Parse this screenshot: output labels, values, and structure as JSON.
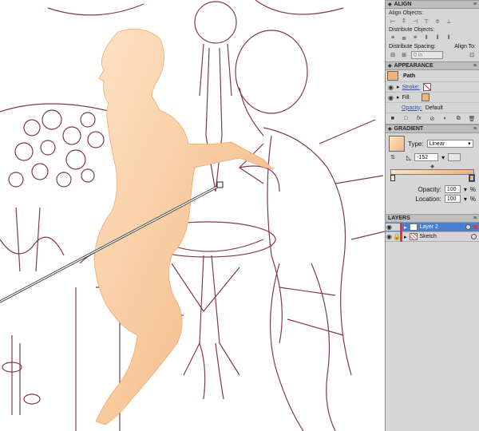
{
  "align": {
    "title": "ALIGN",
    "align_objects_label": "Align Objects:",
    "distribute_objects_label": "Distribute Objects:",
    "distribute_spacing_label": "Distribute Spacing:",
    "align_to_label": "Align To:",
    "spacing_value": "0 in"
  },
  "appearance": {
    "title": "APPEARANCE",
    "object_type": "Path",
    "stroke_label": "Stroke:",
    "fill_label": "Fill:",
    "opacity_label": "Opacity:",
    "opacity_value": "Default",
    "fill_color": "#f3b27a"
  },
  "gradient": {
    "title": "GRADIENT",
    "type_label": "Type:",
    "type_value": "Linear",
    "angle_value": "-152",
    "opacity_label": "Opacity:",
    "opacity_value": "100",
    "location_label": "Location:",
    "location_value": "100",
    "percent": "%",
    "stop_start_color": "#fde3c5",
    "stop_end_color": "#f3b27a"
  },
  "layers": {
    "title": "LAYERS",
    "items": [
      {
        "name": "Layer 2",
        "selected": true,
        "color": "#e33"
      },
      {
        "name": "Sketch",
        "selected": false,
        "color": "#e33"
      }
    ]
  },
  "colors": {
    "sketch_line": "#6e1630",
    "figure_fill": "#f7c48f",
    "panel_bg": "#d6d6d6",
    "selection_blue": "#4a7fd1"
  }
}
